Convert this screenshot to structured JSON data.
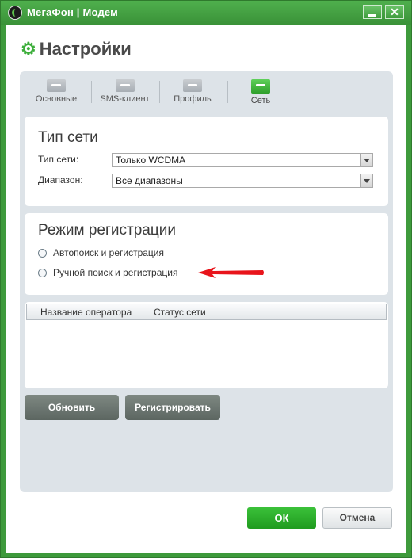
{
  "window": {
    "title": "МегаФон | Модем",
    "accent": "#3e9a3c"
  },
  "page": {
    "title": "Настройки",
    "icon": "gear-icon"
  },
  "tabs": [
    {
      "label": "Основные",
      "icon": "folder-icon"
    },
    {
      "label": "SMS-клиент",
      "icon": "folder-icon"
    },
    {
      "label": "Профиль",
      "icon": "folder-icon"
    },
    {
      "label": "Сеть",
      "icon": "folder-icon",
      "active": true
    }
  ],
  "network_type": {
    "title": "Тип сети",
    "type_label": "Тип сети:",
    "type_value": "Только WCDMA",
    "band_label": "Диапазон:",
    "band_value": "Все диапазоны"
  },
  "registration": {
    "title": "Режим регистрации",
    "options": [
      "Автопоиск и регистрация",
      "Ручной поиск и регистрация"
    ]
  },
  "operators_table": {
    "columns": [
      "Название оператора",
      "Статус сети"
    ],
    "rows": []
  },
  "actions": {
    "refresh": "Обновить",
    "register": "Регистрировать"
  },
  "footer": {
    "ok": "ОК",
    "cancel": "Отмена"
  }
}
